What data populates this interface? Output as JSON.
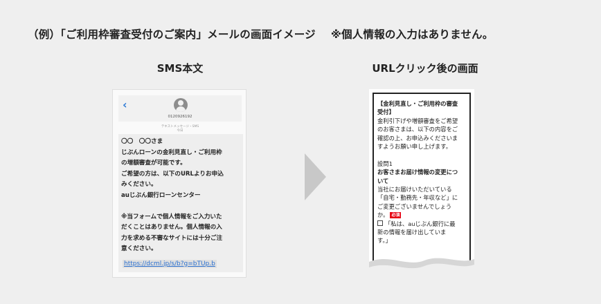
{
  "headline": {
    "main": "（例）「ご利用枠審査受付のご案内」メールの画面イメージ",
    "note": "※個人情報の入力はありません。"
  },
  "labels": {
    "sms": "SMS本文",
    "url": "URLクリック後の画面"
  },
  "sms": {
    "back_icon": "chevron-left-icon",
    "avatar_icon": "person-icon",
    "phone_number": "0120926192",
    "meta_line1": "テキストメッセージ・SMS",
    "meta_line2": "今日",
    "lines": [
      "〇〇　〇〇さま",
      "じぶんローンの金利見直し・ご利用枠",
      "の増額審査が可能です。",
      "ご希望の方は、以下のURLよりお申込",
      "みください。",
      "auじぶん銀行ローンセンター",
      "",
      "※当フォームで個人情報をご入力いた",
      "だくことはありません。個人情報の入",
      "力を求める不審なサイトには十分ご注",
      "意ください。"
    ],
    "link": "https://dcml.jp/s/b?g=bTUp.b",
    "colors": {
      "link": "#2a6fcf",
      "back": "#2f7bd6"
    }
  },
  "url_page": {
    "title_line1": "【金利見直し・ご利用枠の審査",
    "title_line2": "受付】",
    "intro": [
      "金利引下げや増額審査をご希望",
      "のお客さまは、以下の内容をご",
      "確認の上、お申込みくださいま",
      "すようお願い申し上げます。"
    ],
    "question_no": "設問1",
    "question_title_line1": "お客さまお届け情報の変更につ",
    "question_title_line2": "いて",
    "question_body": [
      "当社にお届けいただいている",
      "「自宅・勤務先・年収など」に",
      "ご変更ございませんでしょう"
    ],
    "question_last": "か。",
    "required_badge": "必須",
    "option_line1": "「私は、auじぶん銀行に最",
    "option_line2": "新の情報を届け出していま",
    "option_line3": "す。」",
    "colors": {
      "required": "#e60012"
    }
  }
}
